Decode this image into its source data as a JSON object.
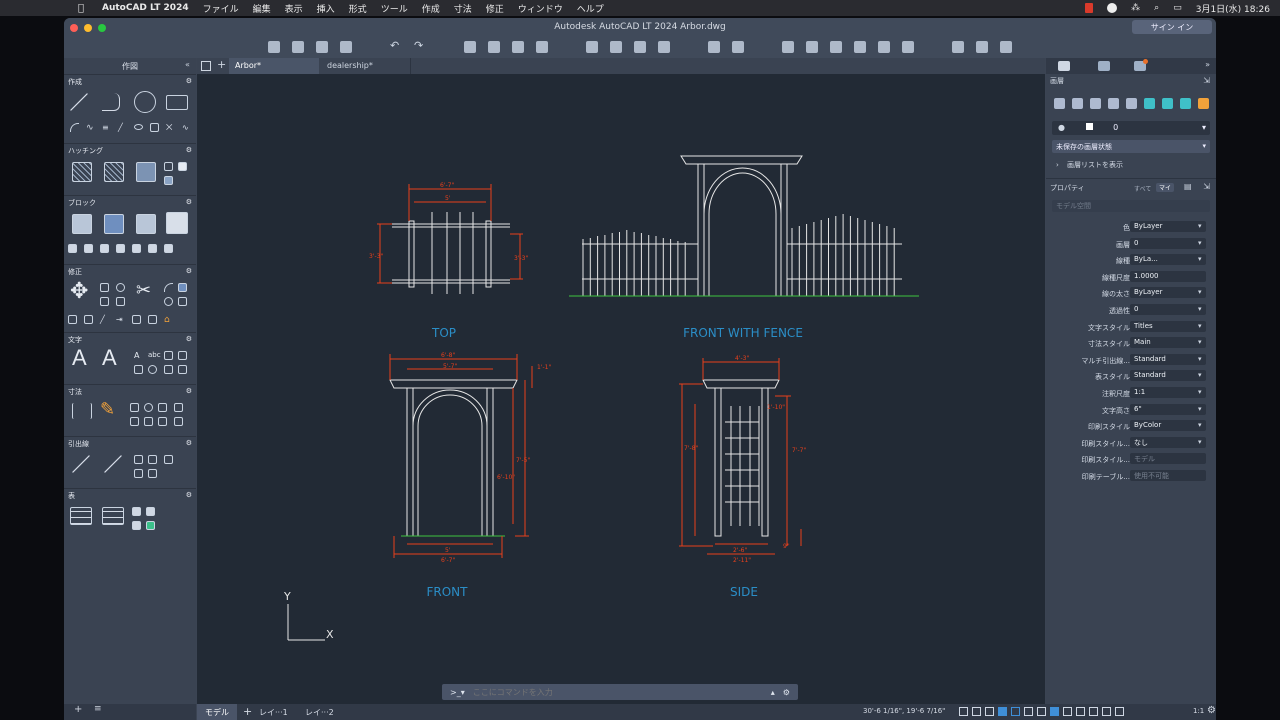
{
  "menubar": {
    "app_name": "AutoCAD LT 2024",
    "items": [
      "ファイル",
      "編集",
      "表示",
      "挿入",
      "形式",
      "ツール",
      "作成",
      "寸法",
      "修正",
      "ウィンドウ",
      "ヘルプ"
    ],
    "clock": "3月1日(水)  18:26"
  },
  "window": {
    "title": "Autodesk AutoCAD LT 2024   Arbor.dwg",
    "sign_in": "サイン イン"
  },
  "tabs": [
    {
      "label": "Arbor*",
      "active": true
    },
    {
      "label": "dealership*",
      "active": false
    }
  ],
  "palette": {
    "title": "作図",
    "sections": [
      "作成",
      "ハッチング",
      "ブロック",
      "修正",
      "文字",
      "寸法",
      "引出線",
      "表"
    ]
  },
  "drawing": {
    "views": [
      "TOP",
      "FRONT WITH FENCE",
      "FRONT",
      "SIDE"
    ],
    "dims": {
      "top_w1": "6'-7\"",
      "top_w2": "5'",
      "top_h1": "3'-3\"",
      "top_h2": "3'-3\"",
      "front_w1": "6'-8\"",
      "front_w2": "5'-7\"",
      "front_w3": "6'-7\"",
      "front_w4": "5'",
      "front_h1": "1'-1\"",
      "front_h2": "7'-5\"",
      "front_h3": "6'-10\"",
      "side_w1": "4'-3\"",
      "side_w2": "2'-6\"",
      "side_w3": "2'-11\"",
      "side_h1": "7'-7\"",
      "side_h2": "7'-8\"",
      "side_h3": "1'-10\"",
      "side_h4": "9\""
    },
    "ucs_x": "X",
    "ucs_y": "Y"
  },
  "command": {
    "placeholder": "ここにコマンドを入力",
    "prompt": ">_▾"
  },
  "layers_panel": {
    "title": "画層",
    "current_layer": "0",
    "state": "未保存の画層状態",
    "show_list": "画層リストを表示"
  },
  "properties": {
    "title": "プロパティ",
    "toggle_a": "すべて",
    "toggle_b": "マイ",
    "space": "モデル空間",
    "rows": [
      {
        "label": "色",
        "value": "ByLayer"
      },
      {
        "label": "画層",
        "value": "0"
      },
      {
        "label": "線種",
        "value": "ByLa..."
      },
      {
        "label": "線種尺度",
        "value": "1.0000"
      },
      {
        "label": "線の太さ",
        "value": "ByLayer"
      },
      {
        "label": "透過性",
        "value": "0"
      },
      {
        "label": "文字スタイル",
        "value": "Titles"
      },
      {
        "label": "寸法スタイル",
        "value": "Main"
      },
      {
        "label": "マルチ引出線...",
        "value": "Standard"
      },
      {
        "label": "表スタイル",
        "value": "Standard"
      },
      {
        "label": "注釈尺度",
        "value": "1:1"
      },
      {
        "label": "文字高さ",
        "value": "6\""
      },
      {
        "label": "印刷スタイル",
        "value": "ByColor"
      },
      {
        "label": "印刷スタイル...",
        "value": "なし"
      },
      {
        "label": "印刷スタイル...",
        "value": "モデル"
      },
      {
        "label": "印刷テーブル...",
        "value": "使用不可能"
      }
    ]
  },
  "status": {
    "model_tab": "モデル",
    "layout1": "レイ···1",
    "layout2": "レイ···2",
    "coords": "30'-6 1/16\", 19'-6 7/16\"",
    "scale": "1:1"
  },
  "colors": {
    "dim": "#e8401c",
    "drawing": "#e6e6e6",
    "label": "#2b8ec7",
    "ground": "#3ec43e",
    "canvas": "#222a35"
  }
}
